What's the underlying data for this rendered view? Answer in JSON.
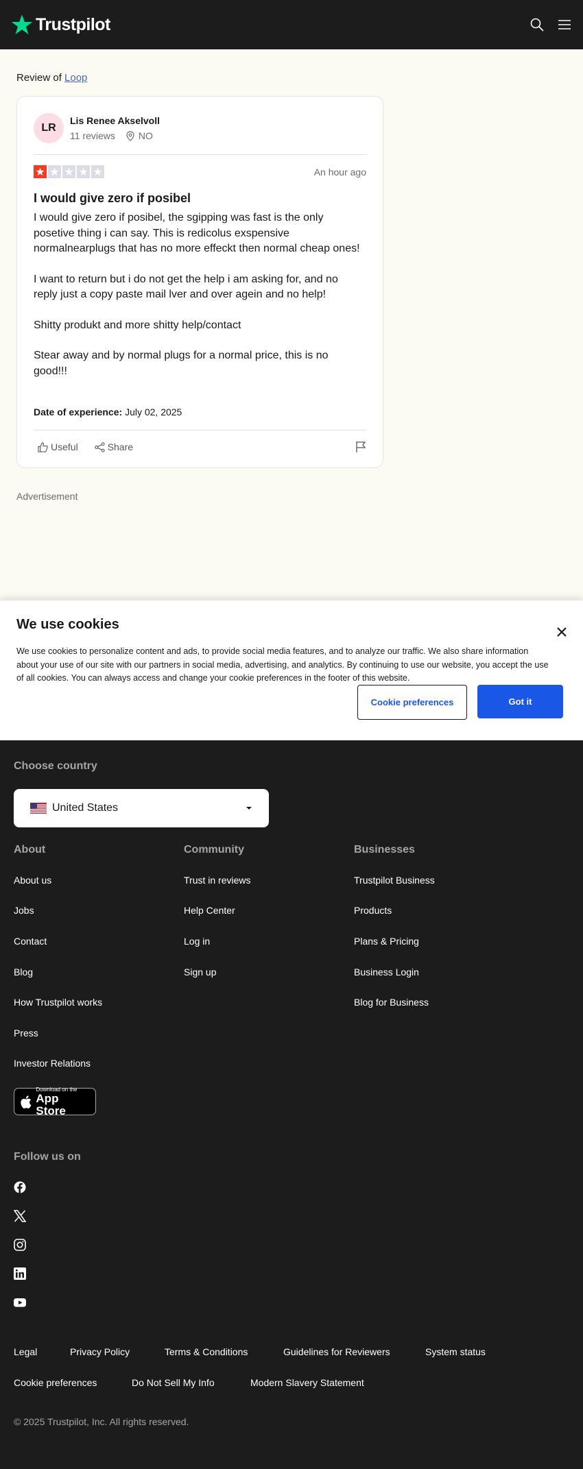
{
  "header": {
    "logo_text": "Trustpilot",
    "icons": [
      "search-icon",
      "menu-icon"
    ]
  },
  "breadcrumb": {
    "prefix": "Review of",
    "company": "Loop"
  },
  "review": {
    "avatar_initials": "LR",
    "reviewer_name": "Lis Renee Akselvoll",
    "reviews_count": "11 reviews",
    "location": "NO",
    "rating": 1,
    "rating_max": 5,
    "time": "An hour ago",
    "title": "I would give zero if posibel",
    "paragraphs": [
      "I would give zero if posibel, the sgipping was fast is the only posetive thing i can say. This is redicolus exspensive normalnearplugs that has no more effeckt then normal cheap ones!",
      "I want to return but i do not get the help i am asking for, and no reply just a copy paste mail lver and over agein and no help!",
      "Shitty produkt and more shitty help/contact",
      "Stear away and by normal plugs for a normal price, this is no good!!!"
    ],
    "date_label": "Date of experience:",
    "date_value": "July 02, 2025",
    "useful_label": "Useful",
    "share_label": "Share"
  },
  "advertisement_label": "Advertisement",
  "cookie_banner": {
    "title": "We use cookies",
    "text": "We use cookies to personalize content and ads, to provide social media features, and to analyze our traffic. We also share information about your use of our site with our partners in social media, advertising, and analytics. By continuing to use our website, you accept the use of all cookies. You can always access and change your cookie preferences in the footer of this website.",
    "preferences_button": "Cookie preferences",
    "accept_button": "Got it"
  },
  "footer": {
    "choose_country_label": "Choose country",
    "selected_country": "United States",
    "about": {
      "heading": "About",
      "links": [
        "About us",
        "Jobs",
        "Contact",
        "Blog",
        "How Trustpilot works",
        "Press",
        "Investor Relations"
      ]
    },
    "community": {
      "heading": "Community",
      "links": [
        "Trust in reviews",
        "Help Center",
        "Log in",
        "Sign up"
      ]
    },
    "businesses": {
      "heading": "Businesses",
      "links": [
        "Trustpilot Business",
        "Products",
        "Plans & Pricing",
        "Business Login",
        "Blog for Business"
      ]
    },
    "app_store": {
      "small": "Download on the",
      "big": "App Store"
    },
    "follow_label": "Follow us on",
    "social": [
      "facebook-icon",
      "x-icon",
      "instagram-icon",
      "linkedin-icon",
      "youtube-icon"
    ],
    "legal_links_row1": [
      "Legal",
      "Privacy Policy",
      "Terms & Conditions",
      "Guidelines for Reviewers",
      "System status"
    ],
    "legal_links_row2": [
      "Cookie preferences",
      "Do Not Sell My Info",
      "Modern Slavery Statement"
    ],
    "copyright": "© 2025 Trustpilot, Inc. All rights reserved."
  },
  "colors": {
    "header_bg": "#1c1c1c",
    "page_bg": "#fcfbf3",
    "star_red": "#ff3722",
    "star_gray": "#dcdce6",
    "brand_green": "#04da8d",
    "button_blue": "#1b57e6"
  }
}
